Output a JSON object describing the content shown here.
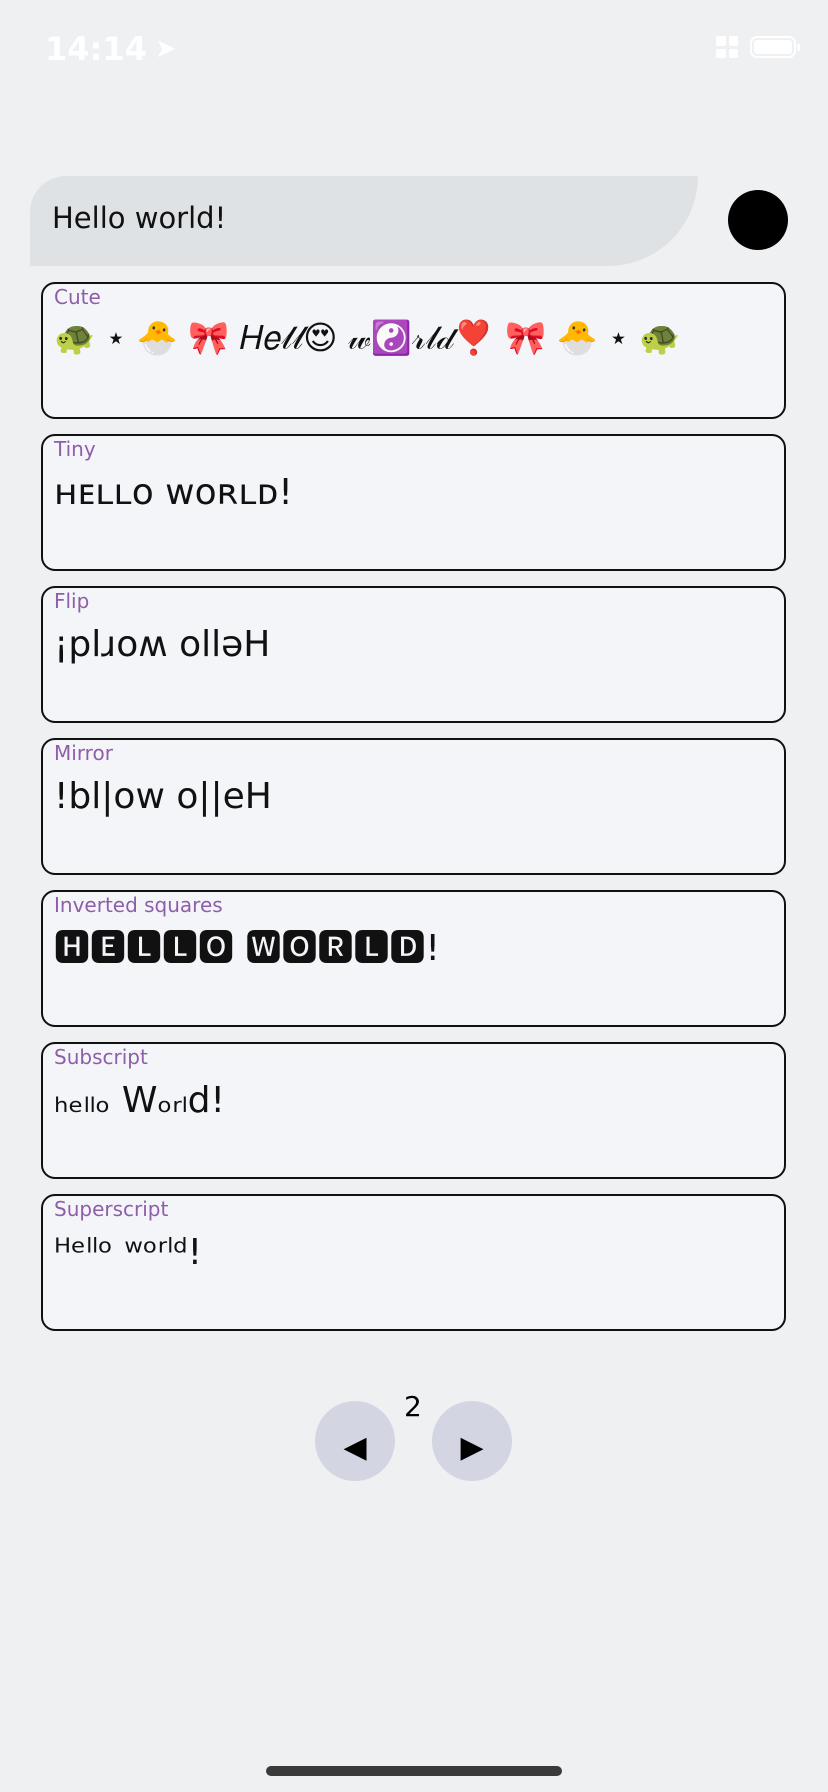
{
  "status_bar": {
    "time": "14:14",
    "location_icon": "location-arrow-icon"
  },
  "input": {
    "value": "Hello world!"
  },
  "cards": [
    {
      "label": "Cute",
      "text": "🐢 ⋆ 🐣  🎀  𝐻𝑒𝓁𝓁😍 𝓌☯️𝓇𝓁𝒹❣️  🎀  🐣 ⋆ 🐢"
    },
    {
      "label": "Tiny",
      "text": "ʜᴇʟʟᴏ ᴡᴏʀʟᴅ!"
    },
    {
      "label": "Flip",
      "text": "¡plɹoʍ olləH"
    },
    {
      "label": "Mirror",
      "text": "!bl|ow o||eH"
    },
    {
      "label": "Inverted squares",
      "text": "🅷🅴🅻🅻🅾 🆆🅾🆁🅻🅳!"
    },
    {
      "label": "Subscript",
      "text": "ₕₑₗₗₒ Wₒᵣₗd!"
    },
    {
      "label": "Superscript",
      "text": "ᴴᵉˡˡᵒ ʷᵒʳˡᵈ!"
    }
  ],
  "pager": {
    "prev_label": "◀",
    "next_label": "▶",
    "page": "2"
  },
  "colors": {
    "label": "#8e5ea8",
    "card_bg": "#f4f5f9",
    "page_bg": "#eef0f2",
    "nav_btn": "#d4d5e2"
  }
}
